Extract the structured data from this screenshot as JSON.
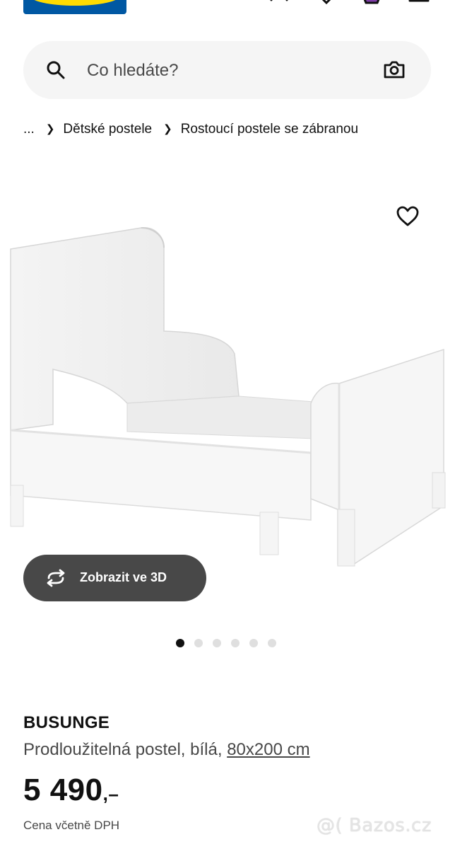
{
  "search": {
    "placeholder": "Co hledáte?"
  },
  "breadcrumb": {
    "items": [
      "...",
      "Dětské postele",
      "Rostoucí postele se zábranou"
    ]
  },
  "gallery": {
    "view_3d_label": "Zobrazit ve 3D",
    "dot_count": 6,
    "active_index": 0
  },
  "product": {
    "name": "BUSUNGE",
    "description": "Prodloužitelná postel, bílá,",
    "size": "80x200 cm",
    "price": "5 490",
    "price_suffix": ",–",
    "vat_note": "Cena včetně DPH"
  },
  "watermark": "@( Bazos.cz",
  "colors": {
    "brand_blue": "#0058a3",
    "brand_yellow": "#ffdb00",
    "button_dark": "#484848"
  },
  "icons": [
    "search-icon",
    "camera-icon",
    "heart-icon",
    "rotate-3d-icon",
    "cart-icon",
    "menu-icon",
    "user-icon",
    "favorites-icon"
  ]
}
